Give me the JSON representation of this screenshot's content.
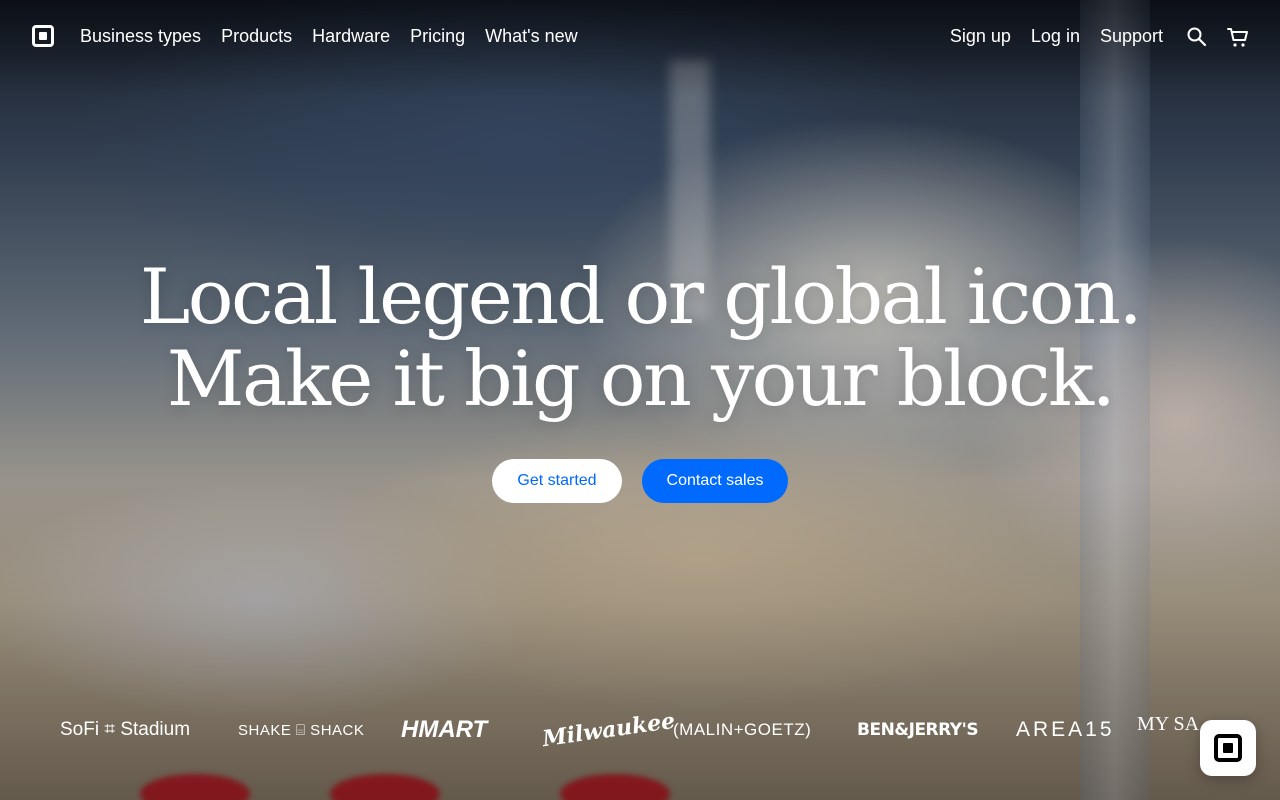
{
  "nav": {
    "logo": "square-logo",
    "links": [
      "Business types",
      "Products",
      "Hardware",
      "Pricing",
      "What's new"
    ],
    "right_links": [
      "Sign up",
      "Log in",
      "Support"
    ],
    "icons": [
      "search-icon",
      "cart-icon"
    ]
  },
  "hero": {
    "headline_line1": "Local legend or global icon.",
    "headline_line2": "Make it big on your block.",
    "primary_cta": "Get started",
    "secondary_cta": "Contact sales",
    "primary_cta_color": "#ffffff",
    "secondary_cta_color": "#006aff"
  },
  "brands": [
    "SoFi ⌗ Stadium",
    "SHAKE ⌸ SHACK",
    "HMART",
    "Milwaukee",
    "(MALIN+GOETZ)",
    "BEN&JERRY'S",
    "AREA15",
    "MY SA…"
  ],
  "chat": {
    "icon": "square-chat-icon"
  }
}
